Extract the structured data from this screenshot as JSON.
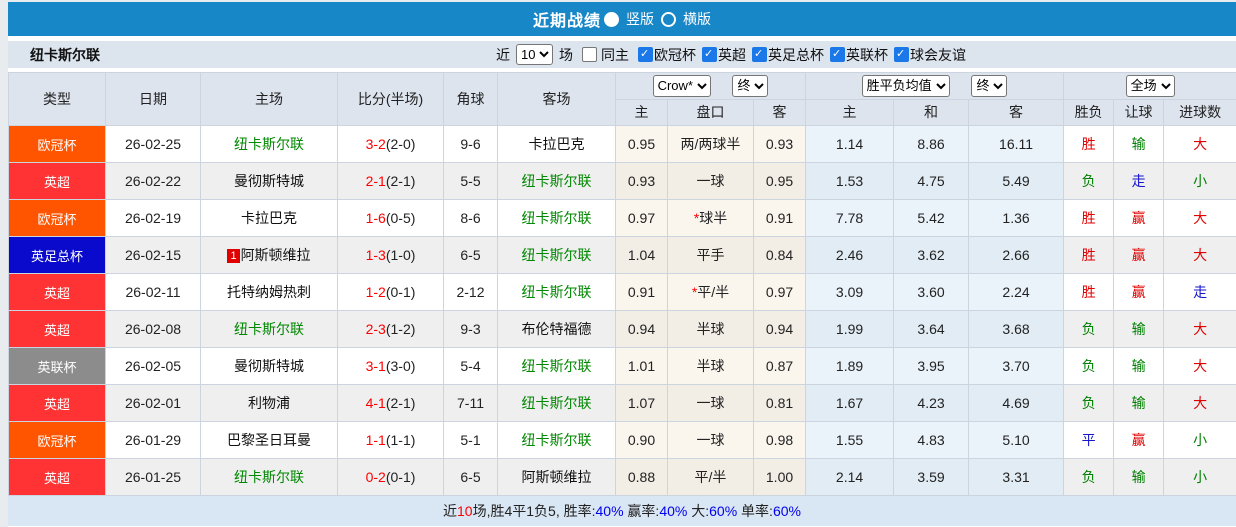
{
  "topbar": {
    "title": "近期战绩",
    "layout_options": [
      {
        "label": "竖版",
        "selected": true
      },
      {
        "label": "横版",
        "selected": false
      }
    ],
    "bar_color": "#1787c8"
  },
  "filterbar": {
    "team_name": "纽卡斯尔联",
    "recent_label": "近",
    "recent_value": "10",
    "matches_label": "场",
    "same_home": {
      "label": "同主",
      "checked": false
    },
    "leagues": [
      {
        "label": "欧冠杯",
        "checked": true
      },
      {
        "label": "英超",
        "checked": true
      },
      {
        "label": "英足总杯",
        "checked": true
      },
      {
        "label": "英联杯",
        "checked": true
      },
      {
        "label": "球会友谊",
        "checked": true
      }
    ]
  },
  "table": {
    "header": {
      "left_cols": [
        "类型",
        "日期",
        "主场",
        "比分(半场)",
        "角球",
        "客场"
      ],
      "odds_select": "Crow*",
      "odds_final_select": "终",
      "mean_select": "胜平负均值",
      "mean_final_select": "终",
      "fullmatch_select": "全场",
      "sub_cols": [
        "主",
        "盘口",
        "客",
        "主",
        "和",
        "客",
        "胜负",
        "让球",
        "进球数"
      ]
    },
    "rows": [
      {
        "league": "欧冠杯",
        "league_color": "#ff5500",
        "date": "26-02-25",
        "home": "纽卡斯尔联",
        "home_self": true,
        "home_redcard": "",
        "score": "3-2",
        "half": "(2-0)",
        "corner": "9-6",
        "away": "卡拉巴克",
        "away_self": false,
        "odds_home": "0.95",
        "handicap": "两/两球半",
        "handicap_star": false,
        "odds_away": "0.93",
        "mean_win": "1.14",
        "mean_draw": "8.86",
        "mean_lose": "16.11",
        "result": "胜",
        "result_color": "red",
        "handicap_result": "输",
        "handicap_result_color": "green",
        "goal_result": "大",
        "goal_result_color": "red"
      },
      {
        "league": "英超",
        "league_color": "#ff3333",
        "date": "26-02-22",
        "home": "曼彻斯特城",
        "home_self": false,
        "home_redcard": "",
        "score": "2-1",
        "half": "(2-1)",
        "corner": "5-5",
        "away": "纽卡斯尔联",
        "away_self": true,
        "odds_home": "0.93",
        "handicap": "一球",
        "handicap_star": false,
        "odds_away": "0.95",
        "mean_win": "1.53",
        "mean_draw": "4.75",
        "mean_lose": "5.49",
        "result": "负",
        "result_color": "green",
        "handicap_result": "走",
        "handicap_result_color": "blue",
        "goal_result": "小",
        "goal_result_color": "green"
      },
      {
        "league": "欧冠杯",
        "league_color": "#ff5500",
        "date": "26-02-19",
        "home": "卡拉巴克",
        "home_self": false,
        "home_redcard": "",
        "score": "1-6",
        "half": "(0-5)",
        "corner": "8-6",
        "away": "纽卡斯尔联",
        "away_self": true,
        "odds_home": "0.97",
        "handicap": "球半",
        "handicap_star": true,
        "odds_away": "0.91",
        "mean_win": "7.78",
        "mean_draw": "5.42",
        "mean_lose": "1.36",
        "result": "胜",
        "result_color": "red",
        "handicap_result": "赢",
        "handicap_result_color": "red",
        "goal_result": "大",
        "goal_result_color": "red"
      },
      {
        "league": "英足总杯",
        "league_color": "#0a0acc",
        "date": "26-02-15",
        "home": "阿斯顿维拉",
        "home_self": false,
        "home_redcard": "1",
        "score": "1-3",
        "half": "(1-0)",
        "corner": "6-5",
        "away": "纽卡斯尔联",
        "away_self": true,
        "odds_home": "1.04",
        "handicap": "平手",
        "handicap_star": false,
        "odds_away": "0.84",
        "mean_win": "2.46",
        "mean_draw": "3.62",
        "mean_lose": "2.66",
        "result": "胜",
        "result_color": "red",
        "handicap_result": "赢",
        "handicap_result_color": "red",
        "goal_result": "大",
        "goal_result_color": "red"
      },
      {
        "league": "英超",
        "league_color": "#ff3333",
        "date": "26-02-11",
        "home": "托特纳姆热刺",
        "home_self": false,
        "home_redcard": "",
        "score": "1-2",
        "half": "(0-1)",
        "corner": "2-12",
        "away": "纽卡斯尔联",
        "away_self": true,
        "odds_home": "0.91",
        "handicap": "平/半",
        "handicap_star": true,
        "odds_away": "0.97",
        "mean_win": "3.09",
        "mean_draw": "3.60",
        "mean_lose": "2.24",
        "result": "胜",
        "result_color": "red",
        "handicap_result": "赢",
        "handicap_result_color": "red",
        "goal_result": "走",
        "goal_result_color": "blue"
      },
      {
        "league": "英超",
        "league_color": "#ff3333",
        "date": "26-02-08",
        "home": "纽卡斯尔联",
        "home_self": true,
        "home_redcard": "",
        "score": "2-3",
        "half": "(1-2)",
        "corner": "9-3",
        "away": "布伦特福德",
        "away_self": false,
        "odds_home": "0.94",
        "handicap": "半球",
        "handicap_star": false,
        "odds_away": "0.94",
        "mean_win": "1.99",
        "mean_draw": "3.64",
        "mean_lose": "3.68",
        "result": "负",
        "result_color": "green",
        "handicap_result": "输",
        "handicap_result_color": "green",
        "goal_result": "大",
        "goal_result_color": "red"
      },
      {
        "league": "英联杯",
        "league_color": "#8c8c8c",
        "date": "26-02-05",
        "home": "曼彻斯特城",
        "home_self": false,
        "home_redcard": "",
        "score": "3-1",
        "half": "(3-0)",
        "corner": "5-4",
        "away": "纽卡斯尔联",
        "away_self": true,
        "odds_home": "1.01",
        "handicap": "半球",
        "handicap_star": false,
        "odds_away": "0.87",
        "mean_win": "1.89",
        "mean_draw": "3.95",
        "mean_lose": "3.70",
        "result": "负",
        "result_color": "green",
        "handicap_result": "输",
        "handicap_result_color": "green",
        "goal_result": "大",
        "goal_result_color": "red"
      },
      {
        "league": "英超",
        "league_color": "#ff3333",
        "date": "26-02-01",
        "home": "利物浦",
        "home_self": false,
        "home_redcard": "",
        "score": "4-1",
        "half": "(2-1)",
        "corner": "7-11",
        "away": "纽卡斯尔联",
        "away_self": true,
        "odds_home": "1.07",
        "handicap": "一球",
        "handicap_star": false,
        "odds_away": "0.81",
        "mean_win": "1.67",
        "mean_draw": "4.23",
        "mean_lose": "4.69",
        "result": "负",
        "result_color": "green",
        "handicap_result": "输",
        "handicap_result_color": "green",
        "goal_result": "大",
        "goal_result_color": "red"
      },
      {
        "league": "欧冠杯",
        "league_color": "#ff5500",
        "date": "26-01-29",
        "home": "巴黎圣日耳曼",
        "home_self": false,
        "home_redcard": "",
        "score": "1-1",
        "half": "(1-1)",
        "corner": "5-1",
        "away": "纽卡斯尔联",
        "away_self": true,
        "odds_home": "0.90",
        "handicap": "一球",
        "handicap_star": false,
        "odds_away": "0.98",
        "mean_win": "1.55",
        "mean_draw": "4.83",
        "mean_lose": "5.10",
        "result": "平",
        "result_color": "blue",
        "handicap_result": "赢",
        "handicap_result_color": "red",
        "goal_result": "小",
        "goal_result_color": "green"
      },
      {
        "league": "英超",
        "league_color": "#ff3333",
        "date": "26-01-25",
        "home": "纽卡斯尔联",
        "home_self": true,
        "home_redcard": "",
        "score": "0-2",
        "half": "(0-1)",
        "corner": "6-5",
        "away": "阿斯顿维拉",
        "away_self": false,
        "odds_home": "0.88",
        "handicap": "平/半",
        "handicap_star": false,
        "odds_away": "1.00",
        "mean_win": "2.14",
        "mean_draw": "3.59",
        "mean_lose": "3.31",
        "result": "负",
        "result_color": "green",
        "handicap_result": "输",
        "handicap_result_color": "green",
        "goal_result": "小",
        "goal_result_color": "green"
      }
    ]
  },
  "summary": {
    "segments": [
      {
        "text": "近",
        "color": "dark"
      },
      {
        "text": "10",
        "color": "red"
      },
      {
        "text": "场,胜4平1负5, 胜率:",
        "color": "dark"
      },
      {
        "text": "40%",
        "color": "blue"
      },
      {
        "text": " 赢率:",
        "color": "dark"
      },
      {
        "text": "40%",
        "color": "blue"
      },
      {
        "text": " 大:",
        "color": "dark"
      },
      {
        "text": "60%",
        "color": "blue"
      },
      {
        "text": " 单率:",
        "color": "dark"
      },
      {
        "text": "60%",
        "color": "blue"
      }
    ]
  }
}
